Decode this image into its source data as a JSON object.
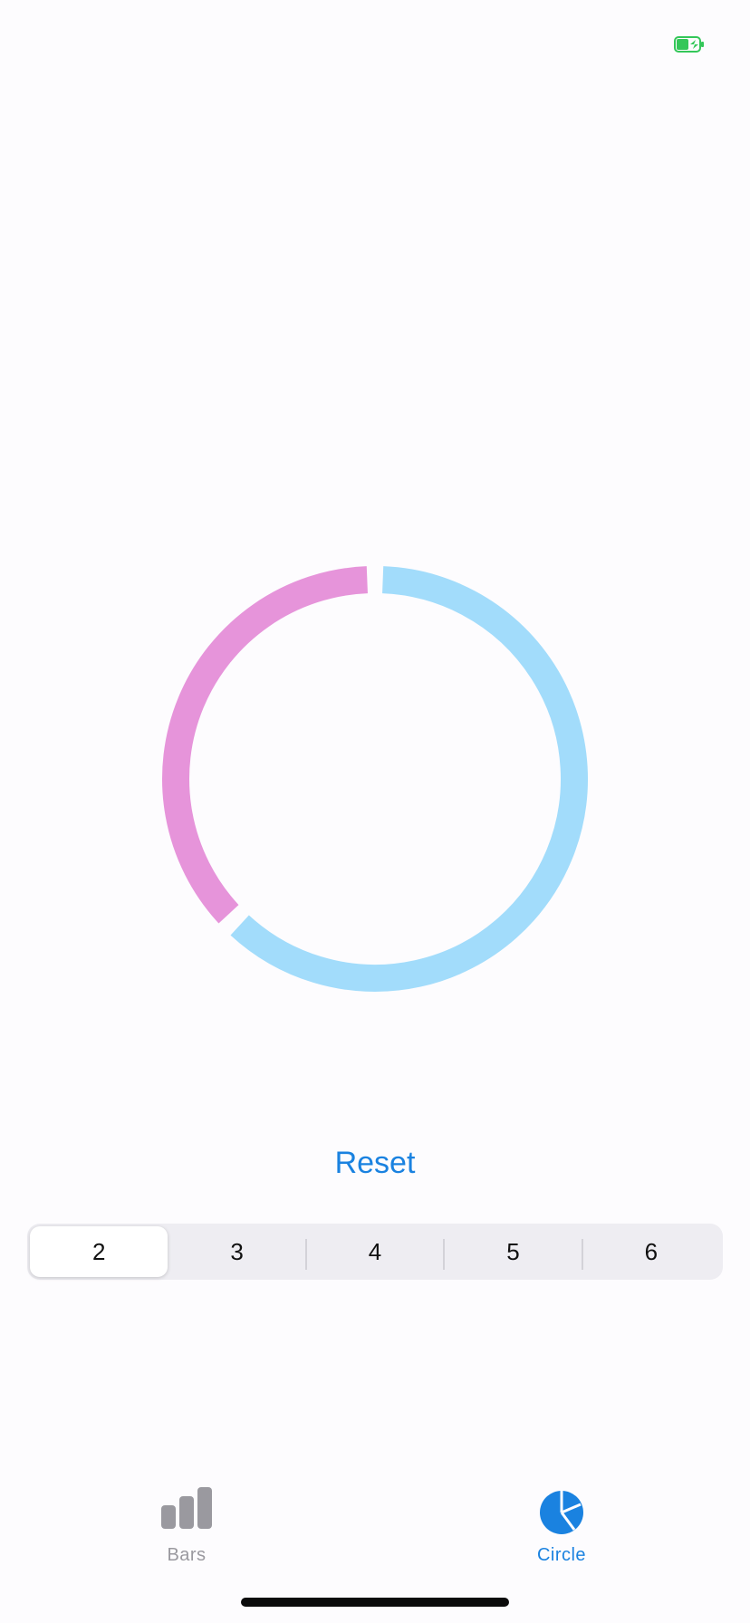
{
  "status_bar": {
    "battery_icon": "battery-charging-icon",
    "battery_color": "#34C759"
  },
  "chart_data": {
    "type": "pie",
    "style": "ring",
    "series": [
      {
        "value": 0.625,
        "color": "#A2DCFB"
      },
      {
        "value": 0.375,
        "color": "#E694DA"
      }
    ]
  },
  "reset_button": {
    "label": "Reset",
    "color": "#1A82E0"
  },
  "segment_control": {
    "options": [
      "2",
      "3",
      "4",
      "5",
      "6"
    ],
    "selected": "2"
  },
  "tab_bar": {
    "items": [
      {
        "label": "Bars",
        "icon": "bar-chart-icon",
        "selected": false
      },
      {
        "label": "Circle",
        "icon": "pie-chart-icon",
        "selected": true
      }
    ],
    "active_color": "#1A82E0",
    "inactive_color": "#9A999F"
  }
}
